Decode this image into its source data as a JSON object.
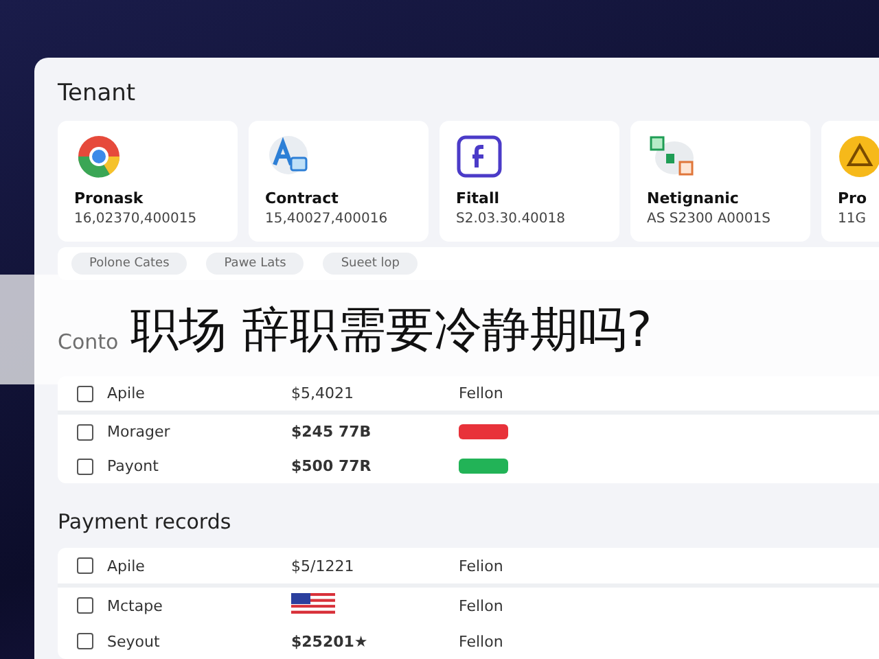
{
  "panel": {
    "title": "Tenant"
  },
  "cards": [
    {
      "kind": "ring",
      "name": "Pronask",
      "value": "16,02370,400015"
    },
    {
      "kind": "letter",
      "name": "Contract",
      "value": "15,40027,400016"
    },
    {
      "kind": "square",
      "name": "Fitall",
      "value": "S2.03.30.40018"
    },
    {
      "kind": "tiles",
      "name": "Netignanic",
      "value": "AS S2300 A0001S"
    },
    {
      "kind": "warning",
      "name": "Pro",
      "value": "11G"
    }
  ],
  "chips": [
    {
      "label": "Polone Cates"
    },
    {
      "label": "Pawe Lats"
    },
    {
      "label": "Sueet lop"
    }
  ],
  "contacts": {
    "title": "Conto",
    "rows": [
      {
        "name": "Apile",
        "amount": "$5,4021",
        "kind": "text",
        "status": "Fellon",
        "checked": false
      },
      {
        "name": "Morager",
        "amount": "$245 77B",
        "kind": "tag",
        "color": "#e8323a",
        "checked": false
      },
      {
        "name": "Payont",
        "amount": "$500 77R",
        "kind": "tag",
        "color": "#22b357",
        "checked": false
      }
    ]
  },
  "payments": {
    "title": "Payment records",
    "rows": [
      {
        "name": "Apile",
        "amount": "$5/1221",
        "kind": "text",
        "status": "Felion",
        "checked": false
      },
      {
        "name": "Mctape",
        "flag": true,
        "kind": "text",
        "status": "Fellon",
        "checked": false
      },
      {
        "name": "Seyout",
        "amount": "$25201★",
        "kind": "text",
        "status": "Fellon",
        "checked": false
      }
    ]
  },
  "banner": {
    "text": "职场 辞职需要冷静期吗?"
  }
}
